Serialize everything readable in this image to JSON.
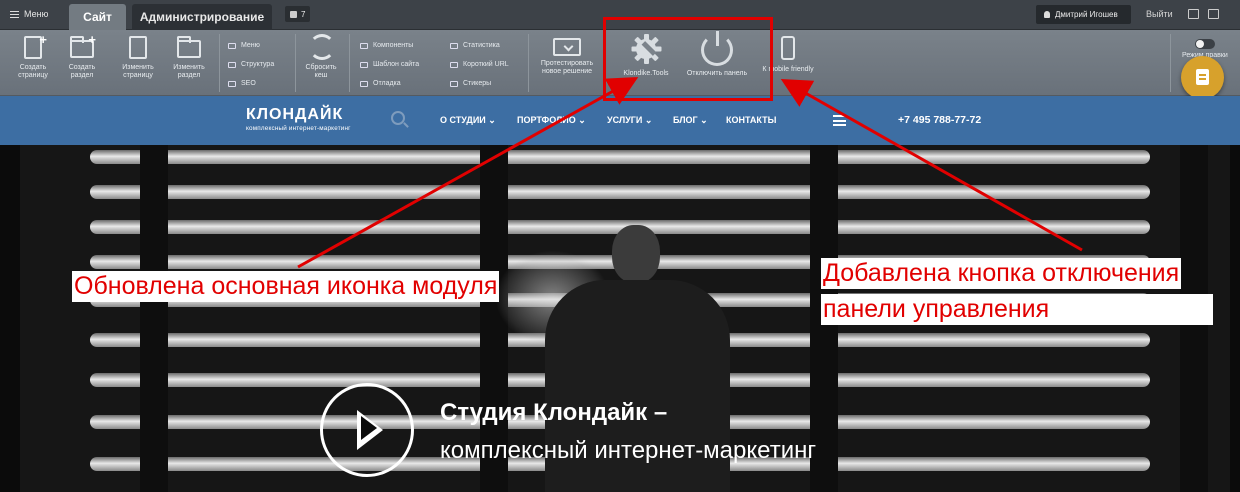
{
  "topbar": {
    "menu_label": "Меню",
    "tab_site": "Сайт",
    "tab_admin": "Администрирование",
    "notif_count": "7",
    "user_name": "Дмитрий Игошев",
    "logout_label": "Выйти"
  },
  "panel": {
    "create_page": [
      "Создать",
      "страницу"
    ],
    "create_section": [
      "Создать",
      "раздел"
    ],
    "edit_page": [
      "Изменить",
      "страницу"
    ],
    "edit_section": [
      "Изменить",
      "раздел"
    ],
    "col1": [
      "Меню",
      "Структура",
      "SEO"
    ],
    "reset_cache": [
      "Сбросить",
      "кеш"
    ],
    "col2": [
      "Компоненты",
      "Шаблон сайта",
      "Отладка"
    ],
    "col3": [
      "Статистика",
      "Короткий URL",
      "Стикеры"
    ],
    "test_solution": [
      "Протестировать",
      "новое решение"
    ],
    "klondike_tools": "Klondike.Tools",
    "disable_panel": "Отключить панель",
    "mobile_friendly": "К mobile friendly",
    "edit_mode": "Режим правки"
  },
  "site": {
    "logo_title": "КЛОНДАЙК",
    "logo_sub": "комплексный интернет-маркетинг",
    "nav": [
      "О СТУДИИ",
      "ПОРТФОЛИО",
      "УСЛУГИ",
      "БЛОГ",
      "КОНТАКТЫ"
    ],
    "phone": "+7 495 788-77-72"
  },
  "hero": {
    "title": "Студия Клондайк –",
    "subtitle": "комплексный интернет-маркетинг"
  },
  "annotations": {
    "left_caption": "Обновлена основная иконка модуля",
    "right_caption_line1": "Добавлена кнопка отключения",
    "right_caption_line2": "панели управления"
  },
  "colors": {
    "panel": "#727a82",
    "site_header": "#3d6ea3",
    "annotation_red": "#e10000",
    "fab": "#d7a12c"
  }
}
